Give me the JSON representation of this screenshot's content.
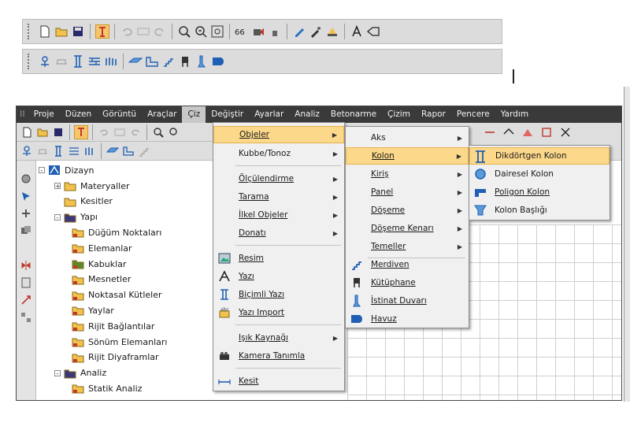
{
  "top_toolbar": {
    "row1_icons": [
      "new-file-icon",
      "open-folder-icon",
      "save-icon",
      "highlight-tool-icon",
      "undo-icon",
      "undo-list-icon",
      "redo-icon",
      "zoom-icon",
      "zoom-window-icon",
      "zoom-extent-icon",
      "measure-icon",
      "render-icon",
      "properties-icon",
      "pencil-icon",
      "brush-icon",
      "light-icon",
      "text-a-icon",
      "eraser-icon"
    ],
    "row2_icons": [
      "axis-icon",
      "beam-icon",
      "column-icon",
      "wall-icon",
      "panel-icon",
      "slab-icon",
      "foundation-icon",
      "stair-icon",
      "library-icon",
      "retaining-wall-icon",
      "pool-icon"
    ]
  },
  "menubar": {
    "items": [
      "Proje",
      "Düzen",
      "Görüntü",
      "Araçlar",
      "Çiz",
      "Değiştir",
      "Ayarlar",
      "Analiz",
      "Betonarme",
      "Çizim",
      "Rapor",
      "Pencere",
      "Yardım"
    ]
  },
  "tree": {
    "root": "Dizayn",
    "children": [
      {
        "label": "Materyaller",
        "level": 1,
        "toggle": "+"
      },
      {
        "label": "Kesitler",
        "level": 1,
        "toggle": ""
      },
      {
        "label": "Yapı",
        "level": 1,
        "toggle": "-"
      },
      {
        "label": "Düğüm Noktaları",
        "level": 2
      },
      {
        "label": "Elemanlar",
        "level": 2
      },
      {
        "label": "Kabuklar",
        "level": 2
      },
      {
        "label": "Mesnetler",
        "level": 2
      },
      {
        "label": "Noktasal Kütleler",
        "level": 2
      },
      {
        "label": "Yaylar",
        "level": 2
      },
      {
        "label": "Rijit Bağlantılar",
        "level": 2
      },
      {
        "label": "Sönüm Elemanları",
        "level": 2
      },
      {
        "label": "Rijit Diyaframlar",
        "level": 2
      },
      {
        "label": "Analiz",
        "level": 1,
        "toggle": "-"
      },
      {
        "label": "Statik Analiz",
        "level": 2
      }
    ]
  },
  "menu_ciz": {
    "items": [
      {
        "label": "Objeler",
        "submenu": true,
        "highlighted": true
      },
      {
        "label": "Kubbe/Tonoz",
        "submenu": true
      },
      {
        "label": "Ölçülendirme",
        "submenu": true
      },
      {
        "label": "Tarama",
        "submenu": true
      },
      {
        "label": "İlkel Objeler",
        "submenu": true
      },
      {
        "label": "Donatı",
        "submenu": true
      },
      {
        "label": "Resim",
        "icon": "image-icon"
      },
      {
        "label": "Yazı",
        "icon": "text-a-icon"
      },
      {
        "label": "Biçimli Yazı",
        "icon": "formatted-text-icon"
      },
      {
        "label": "Yazı Import",
        "icon": "text-import-icon"
      },
      {
        "label": "Işık Kaynağı",
        "submenu": true
      },
      {
        "label": "Kamera Tanımla",
        "icon": "camera-icon"
      },
      {
        "label": "Kesit",
        "icon": "section-icon"
      }
    ]
  },
  "menu_objeler": {
    "items": [
      {
        "label": "Aks",
        "submenu": true
      },
      {
        "label": "Kolon",
        "submenu": true,
        "highlighted": true
      },
      {
        "label": "Kiriş",
        "submenu": true
      },
      {
        "label": "Panel",
        "submenu": true
      },
      {
        "label": "Döşeme",
        "submenu": true
      },
      {
        "label": "Döşeme Kenarı",
        "submenu": true
      },
      {
        "label": "Temeller",
        "submenu": true
      },
      {
        "label": "Merdiven",
        "icon": "stair-icon"
      },
      {
        "label": "Kütüphane",
        "icon": "library-icon"
      },
      {
        "label": "İstinat Duvarı",
        "icon": "retaining-wall-icon"
      },
      {
        "label": "Havuz",
        "icon": "pool-icon"
      }
    ]
  },
  "menu_kolon": {
    "items": [
      {
        "label": "Dikdörtgen Kolon",
        "icon": "rect-column-icon",
        "highlighted": true
      },
      {
        "label": "Dairesel Kolon",
        "icon": "circular-column-icon"
      },
      {
        "label": "Poligon Kolon",
        "icon": "polygon-column-icon"
      },
      {
        "label": "Kolon Başlığı",
        "icon": "column-cap-icon"
      }
    ]
  },
  "colors": {
    "menubar_bg": "#3a3a3a",
    "highlight": "#fbd88a",
    "folder": "#f2c14e",
    "icon_blue": "#1f5fb4"
  }
}
